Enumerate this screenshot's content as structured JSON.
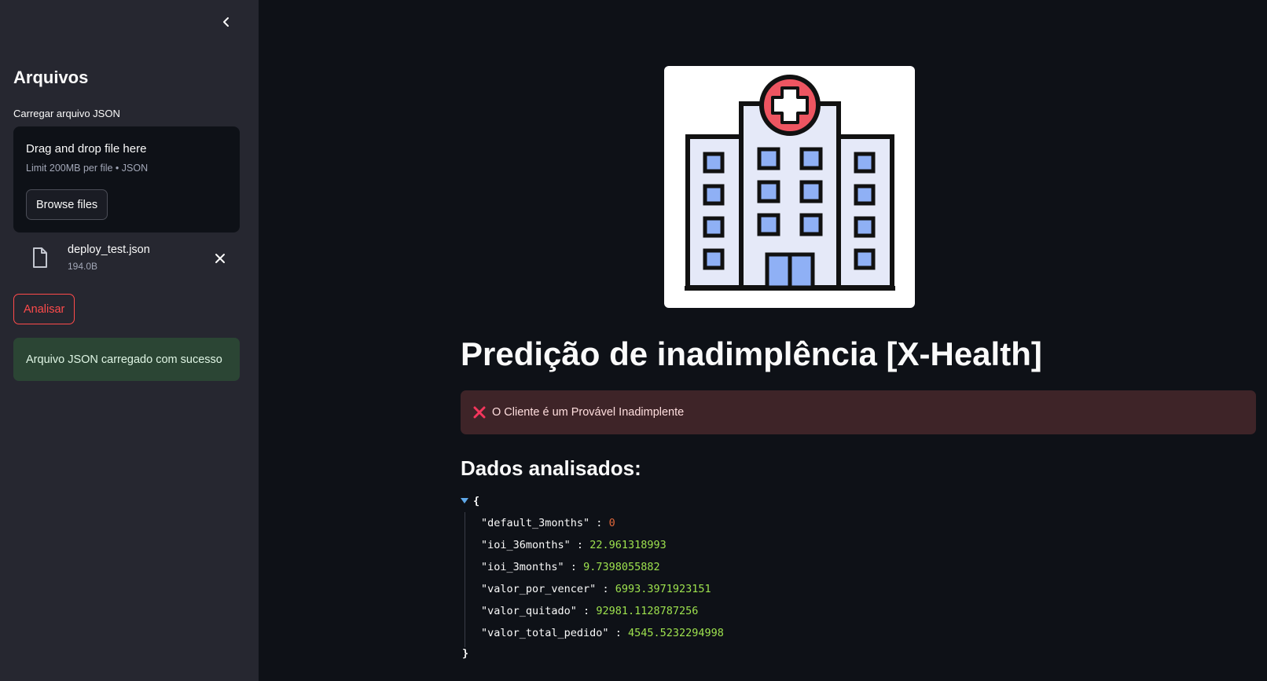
{
  "sidebar": {
    "title": "Arquivos",
    "uploader_label": "Carregar arquivo JSON",
    "dropzone": {
      "title": "Drag and drop file here",
      "limit": "Limit 200MB per file • JSON",
      "browse_label": "Browse files"
    },
    "file": {
      "name": "deploy_test.json",
      "size": "194.0B"
    },
    "analyze_label": "Analisar",
    "success_message": "Arquivo JSON carregado com sucesso"
  },
  "main": {
    "title": "Predição de inadimplência [X-Health]",
    "error_message": "O Cliente é um Provável Inadimplente",
    "subtitle": "Dados analisados:",
    "json": {
      "open": "{",
      "close": "}",
      "rows": [
        {
          "key": "\"default_3months\"",
          "value": "0"
        },
        {
          "key": "\"ioi_36months\"",
          "value": "22.961318993"
        },
        {
          "key": "\"ioi_3months\"",
          "value": "9.7398055882"
        },
        {
          "key": "\"valor_por_vencer\"",
          "value": "6993.3971923151"
        },
        {
          "key": "\"valor_quitado\"",
          "value": "92981.1128787256"
        },
        {
          "key": "\"valor_total_pedido\"",
          "value": "4545.5232294998"
        }
      ]
    }
  },
  "colors": {
    "background": "#0e1117",
    "sidebar": "#262730",
    "accent": "#ff4b4b",
    "success_bg": "#2b4534",
    "error_bg": "#3e2428"
  },
  "icons": [
    "chevron-left-icon",
    "file-icon",
    "close-icon",
    "error-x-icon",
    "hospital-logo",
    "caret-down-icon"
  ]
}
